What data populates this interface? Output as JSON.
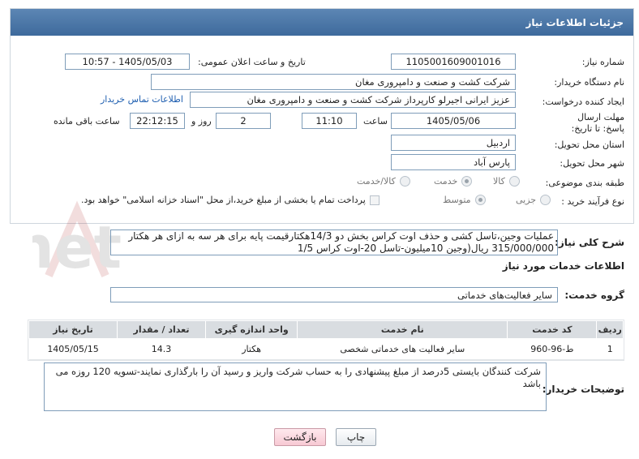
{
  "panel": {
    "title": "جزئیات اطلاعات نیاز"
  },
  "labels": {
    "need_number": "شماره نیاز:",
    "announce_datetime": "تاریخ و ساعت اعلان عمومی:",
    "buyer_org": "نام دستگاه خریدار:",
    "requester": "ایجاد کننده درخواست:",
    "reply_deadline": "مهلت ارسال پاسخ: تا تاریخ:",
    "time": "ساعت",
    "days_and": "روز و",
    "remaining": "ساعت باقی مانده",
    "province": "استان محل تحویل:",
    "city": "شهر محل تحویل:",
    "category": "طبقه بندی موضوعی:",
    "process_type": "نوع فرآیند خرید :",
    "general_desc": "شرح کلی نیاز:",
    "services_section": "اطلاعات خدمات مورد نیاز",
    "service_group": "گروه خدمت:",
    "buyer_notes": "توضیحات خریدار:"
  },
  "fields": {
    "need_number": "1105001609001016",
    "announce_datetime": "1405/05/03 - 10:57",
    "buyer_org": "شرکت کشت و صنعت و دامپروری مغان",
    "requester": "عزیز ایرانی اجیرلو کارپرداز شرکت کشت و صنعت و دامپروری مغان",
    "contact_link": "اطلاعات تماس خریدار",
    "deadline_date": "1405/05/06",
    "deadline_time": "11:10",
    "days_left": "2",
    "time_left": "22:12:15",
    "province": "اردبیل",
    "city": "پارس آباد",
    "service_group": "سایر فعالیت‌های خدماتی"
  },
  "category_options": [
    {
      "label": "کالا",
      "selected": false
    },
    {
      "label": "خدمت",
      "selected": true
    },
    {
      "label": "کالا/خدمت",
      "selected": false
    }
  ],
  "process_options": [
    {
      "label": "جزیی",
      "selected": false
    },
    {
      "label": "متوسط",
      "selected": true
    }
  ],
  "payment_note": "پرداخت تمام یا بخشی از مبلغ خرید،از محل \"اسناد خزانه اسلامی\" خواهد بود.",
  "general_desc": {
    "line1": "عملیات وجین،تاسل کشی و حذف اوت کراس بخش دو 14/3هکتارقیمت پایه برای هر سه به ازای هر هکتار",
    "line2": "315/000/000 ریال(وجین 10میلیون-تاسل 20-اوت کراس 1/5"
  },
  "table": {
    "headers": [
      "ردیف",
      "کد خدمت",
      "نام خدمت",
      "واحد اندازه گیری",
      "تعداد / مقدار",
      "تاریخ نیاز"
    ],
    "rows": [
      [
        "1",
        "ط-96-960",
        "سایر فعالیت های خدماتی شخصی",
        "هکتار",
        "14.3",
        "1405/05/15"
      ]
    ]
  },
  "buyer_notes": "شرکت کنندگان بایستی 5درصد از مبلغ پیشنهادی را به حساب شرکت واریز و رسید آن را بارگذاری نمایند-تسویه 120 روزه می باشد",
  "buttons": {
    "print": "چاپ",
    "back": "بازگشت"
  },
  "watermark": "AriaTender.net"
}
